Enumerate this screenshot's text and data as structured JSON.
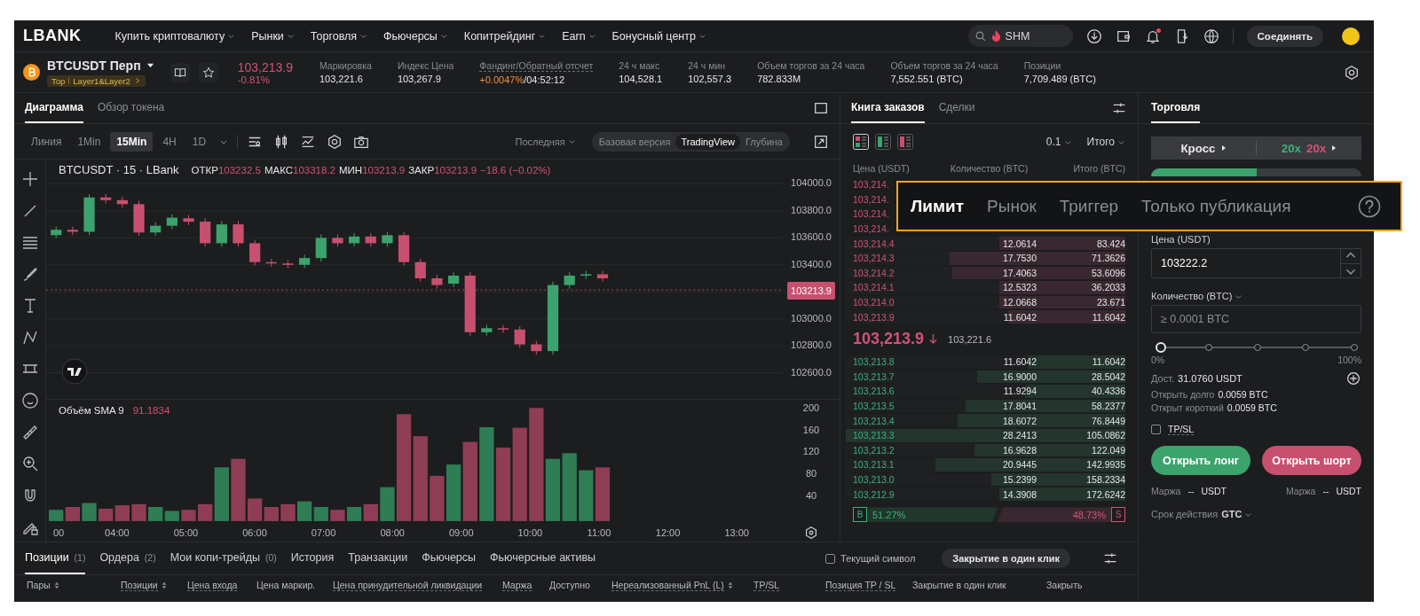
{
  "nav": {
    "logo": "LBANK",
    "menu": [
      {
        "label": "Купить криптовалюту"
      },
      {
        "label": "Рынки"
      },
      {
        "label": "Торговля"
      },
      {
        "label": "Фьючерсы"
      },
      {
        "label": "Копитрейдинг"
      },
      {
        "label": "Earn"
      },
      {
        "label": "Бонусный центр"
      }
    ],
    "search": {
      "placeholder": "SHM"
    },
    "unread": true,
    "connect_button": "Соединять"
  },
  "ticker": {
    "symbol": "BTCUSDT Перп",
    "tags": [
      "Top",
      "Layer1&Layer2"
    ],
    "price": "103,213.9",
    "change": "-0.81%",
    "stats": [
      {
        "kind": "plain",
        "label": "Маркировка",
        "value": "103,221.6"
      },
      {
        "kind": "plain",
        "label": "Индекс Цена",
        "value": "103,267.9"
      },
      {
        "kind": "funding",
        "label": "Фандинг/Обратный отсчет",
        "value": "+0.0047%",
        "suffix": "/04:52:12"
      },
      {
        "kind": "plain",
        "label": "24 ч макс",
        "value": "104,528.1"
      },
      {
        "kind": "plain",
        "label": "24 ч мин",
        "value": "102,557.3"
      },
      {
        "kind": "plain",
        "label": "Объем торгов за 24 часа",
        "value": "782.833M"
      },
      {
        "kind": "plain",
        "label": "Объем торгов за 24 часа",
        "value": "7,552.551 (BTC)"
      },
      {
        "kind": "plain",
        "label": "Позиции",
        "value": "7,709.489 (BTC)"
      }
    ]
  },
  "chart": {
    "tabs": [
      {
        "label": "Диаграмма",
        "selected": true
      },
      {
        "label": "Обзор токена",
        "selected": false
      }
    ],
    "intervals": [
      {
        "label": "Линия",
        "selected": false
      },
      {
        "label": "1Min",
        "selected": false
      },
      {
        "label": "15Min",
        "selected": true
      },
      {
        "label": "4H",
        "selected": false
      },
      {
        "label": "1D",
        "selected": false
      }
    ],
    "price_type": "Последняя",
    "views": [
      {
        "label": "Базовая версия",
        "selected": false
      },
      {
        "label": "TradingView",
        "selected": true
      },
      {
        "label": "Глубина",
        "selected": false
      }
    ],
    "legend": {
      "title": "BTCUSDT · 15 · LBank",
      "values": [
        {
          "label": "ОТКР",
          "value": "103232.5"
        },
        {
          "label": "МАКС",
          "value": "103318.2"
        },
        {
          "label": "МИН",
          "value": "103213.9"
        },
        {
          "label": "ЗАКР",
          "value": "103213.9"
        }
      ],
      "change": "−18.6 (−0.02%)"
    },
    "price_axis": [
      {
        "kind": "tick",
        "label": "104000.0"
      },
      {
        "kind": "tick",
        "label": "103800.0"
      },
      {
        "kind": "tick",
        "label": "103600.0"
      },
      {
        "kind": "tick",
        "label": "103400.0"
      },
      {
        "kind": "last",
        "label": "103213.9"
      },
      {
        "kind": "tick",
        "label": "103000.0"
      },
      {
        "kind": "tick",
        "label": "102800.0"
      },
      {
        "kind": "tick",
        "label": "102600.0"
      }
    ],
    "volume_legend": {
      "label": "Объём SMA 9",
      "value": "91.1834"
    },
    "volume_axis": [
      "200",
      "160",
      "120",
      "80",
      "40"
    ],
    "time_axis": [
      "00",
      "04:00",
      "05:00",
      "06:00",
      "07:00",
      "08:00",
      "09:00",
      "10:00",
      "11:00",
      "12:00",
      "13:00"
    ]
  },
  "orderbook": {
    "tabs": [
      {
        "label": "Книга заказов",
        "selected": true
      },
      {
        "label": "Сделки",
        "selected": false
      }
    ],
    "views": [
      {
        "kind": "both",
        "selected": true
      },
      {
        "kind": "bids",
        "selected": false
      },
      {
        "kind": "asks",
        "selected": false
      }
    ],
    "tick_size": "0.1",
    "total_mode": "Итого",
    "columns": [
      "Цена (USDT)",
      "Количество (BTC)",
      "Итого (BTC)"
    ],
    "asks": [
      {
        "price": "103,214."
      },
      {
        "price": "103,214."
      },
      {
        "price": "103,214."
      },
      {
        "price": "103,214."
      },
      {
        "price": "103,214.4",
        "amount": "12.0614",
        "total": "83.424",
        "level": 0.45
      },
      {
        "price": "103,214.3",
        "amount": "17.7530",
        "total": "71.3626",
        "level": 0.63
      },
      {
        "price": "103,214.2",
        "amount": "17.4063",
        "total": "53.6096",
        "level": 0.62
      },
      {
        "price": "103,214.1",
        "amount": "12.5323",
        "total": "36.2033",
        "level": 0.45
      },
      {
        "price": "103,214.0",
        "amount": "12.0668",
        "total": "23.671",
        "level": 0.45
      },
      {
        "price": "103,213.9",
        "amount": "11.6042",
        "total": "11.6042",
        "level": 0.42
      }
    ],
    "last_price": "103,213.9",
    "mark_price": "103,221.6",
    "bids": [
      {
        "price": "103,213.8",
        "amount": "11.6042",
        "total": "11.6042",
        "level": 0.35
      },
      {
        "price": "103,213.7",
        "amount": "16.9000",
        "total": "28.5042",
        "level": 0.53
      },
      {
        "price": "103,213.6",
        "amount": "11.9294",
        "total": "40.4336",
        "level": 0.36
      },
      {
        "price": "103,213.5",
        "amount": "17.8041",
        "total": "58.2377",
        "level": 0.57
      },
      {
        "price": "103,213.4",
        "amount": "18.6072",
        "total": "76.8449",
        "level": 0.6
      },
      {
        "price": "103,213.3",
        "amount": "28.2413",
        "total": "105.0862",
        "level": 1
      },
      {
        "price": "103,213.2",
        "amount": "16.9628",
        "total": "122.049",
        "level": 0.54
      },
      {
        "price": "103,213.1",
        "amount": "20.9445",
        "total": "142.9935",
        "level": 0.68
      },
      {
        "price": "103,213.0",
        "amount": "15.2399",
        "total": "158.2334",
        "level": 0.48
      },
      {
        "price": "103,212.9",
        "amount": "14.3908",
        "total": "172.6242",
        "level": 0.45
      }
    ],
    "buy_ratio": {
      "label": "B",
      "share": "51.27%",
      "level": 0.5127
    },
    "sell_ratio": {
      "share": "48.73%",
      "label": "S"
    }
  },
  "trade": {
    "tab": "Торговля",
    "margin_mode": "Кросс",
    "leverage_long": "20x",
    "leverage_short": "20x",
    "sides": [
      {
        "selected": true
      },
      {
        "selected": false
      }
    ],
    "price_label": "Цена (USDT)",
    "price_value": "103222.2",
    "qty_label": "Количество (BTC)",
    "qty_placeholder": "≥ 0.0001 BTC",
    "slider": {
      "level": 0,
      "min_label": "0%",
      "max_label": "100%"
    },
    "available_label": "Дост.",
    "available": "31.0760 USDT",
    "open_long_label": "Открыть долго",
    "open_long": "0.0059 BTC",
    "open_short_label": "Открыт короткий",
    "open_short": "0.0059 BTC",
    "tpsl": {
      "label": "TP/SL",
      "checked": false
    },
    "long_button": "Открыть лонг",
    "short_button": "Открыть шорт",
    "margins": [
      {
        "label": "Маржа",
        "value": "--",
        "unit": "USDT"
      },
      {
        "label": "Маржа",
        "value": "--",
        "unit": "USDT"
      }
    ],
    "tif_label": "Срок действия",
    "tif": "GTC"
  },
  "positions": {
    "tabs": [
      {
        "label": "Позиции",
        "count": "(1)",
        "selected": true
      },
      {
        "label": "Ордера",
        "count": "(2)",
        "selected": false
      },
      {
        "label": "Мои копи-трейды",
        "count": "(0)",
        "selected": false
      },
      {
        "label": "История",
        "selected": false
      },
      {
        "label": "Транзакции",
        "selected": false
      },
      {
        "label": "Фьючерсы",
        "selected": false
      },
      {
        "label": "Фьючерсные активы",
        "selected": false
      }
    ],
    "current_symbol": {
      "label": "Текущий символ",
      "checked": false
    },
    "close_all_button": "Закрытие в один клик",
    "columns": [
      {
        "label": "Пары",
        "sortable": true,
        "hint": false
      },
      {
        "label": "Позиции",
        "sortable": true,
        "hint": true
      },
      {
        "label": "Цена входа",
        "sortable": false,
        "hint": true
      },
      {
        "label": "Цена маркир.",
        "sortable": false,
        "hint": false
      },
      {
        "label": "Цена принудительной ликвидации",
        "sortable": false,
        "hint": true
      },
      {
        "label": "Маржа",
        "sortable": false,
        "hint": true
      },
      {
        "label": "Доступно",
        "sortable": false,
        "hint": false
      },
      {
        "label": "Нереализованный PnL (L)",
        "sortable": true,
        "hint": true
      },
      {
        "label": "TP/SL",
        "sortable": false,
        "hint": true
      },
      {
        "label": "Позиция TP / SL",
        "sortable": false,
        "hint": true
      },
      {
        "label": "Закрытие в один клик",
        "sortable": false,
        "hint": false
      },
      {
        "label": "Закрыть",
        "sortable": false,
        "hint": false
      }
    ]
  },
  "order_type_overlay": {
    "tabs": [
      {
        "label": "Лимит",
        "selected": true
      },
      {
        "label": "Рынок",
        "selected": false
      },
      {
        "label": "Триггер",
        "selected": false
      },
      {
        "label": "Только публикация",
        "selected": false
      }
    ]
  }
}
